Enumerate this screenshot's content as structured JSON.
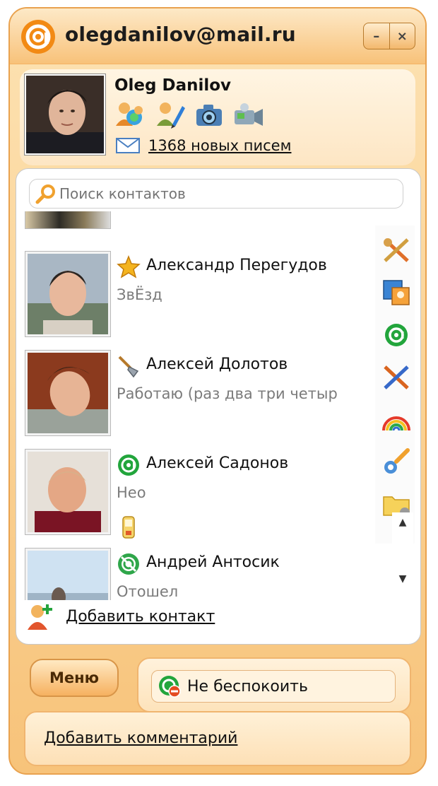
{
  "window": {
    "title": "olegdanilov@mail.ru",
    "minimize_glyph": "–",
    "close_glyph": "×"
  },
  "profile": {
    "name": "Oleg Danilov",
    "mail_text": "1368 новых писем",
    "icons": [
      "contacts-icon",
      "edit-profile-icon",
      "camera-icon",
      "video-icon"
    ]
  },
  "search": {
    "placeholder": "Поиск контактов"
  },
  "contacts": [
    {
      "name": "Александр Перегудов",
      "mood": "ЗвЁзд",
      "status": "star-icon"
    },
    {
      "name": "Алексей Долотов",
      "mood": "Работаю (раз два три четыр",
      "status": "shovel-icon"
    },
    {
      "name": "Алексей Садонов",
      "mood": "Нео",
      "status": "online-icon",
      "extra": "mobile-icon"
    },
    {
      "name": "Андрей Антосик",
      "mood": "Отошел",
      "status": "away-icon"
    }
  ],
  "sidebar_tools": [
    "settings-tools-icon",
    "photo-icon",
    "mail-at-icon",
    "games-icon",
    "themes-rainbow-icon",
    "tools-icon",
    "folder-icon"
  ],
  "add_contact": {
    "label": "Добавить контакт"
  },
  "menu": {
    "label": "Меню"
  },
  "status": {
    "label": "Не беспокоить"
  },
  "comment": {
    "label": "Добавить комментарий"
  },
  "colors": {
    "accent": "#f6b160",
    "frame": "#e9a24f",
    "online": "#22a53c",
    "dnd": "#e44b1f"
  }
}
